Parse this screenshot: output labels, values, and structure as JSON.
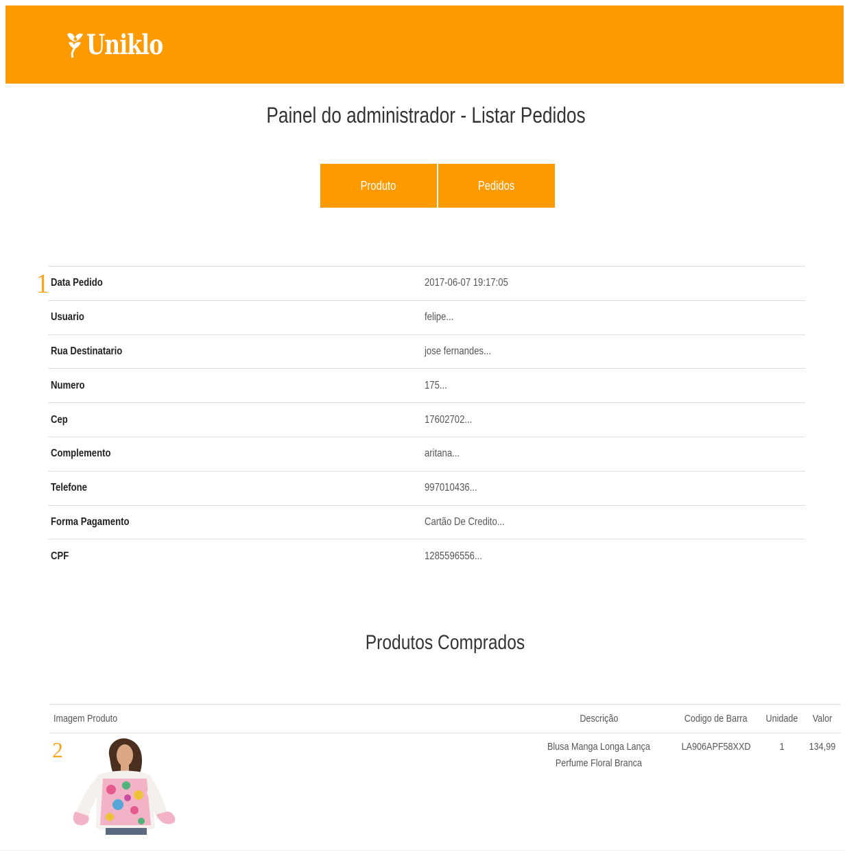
{
  "header": {
    "brand": "Uniklo",
    "logo_icon": "flower-logo-icon",
    "background_color": "#fe9a01"
  },
  "page_title": "Painel do administrador - Listar Pedidos",
  "nav": {
    "produto_label": "Produto",
    "pedidos_label": "Pedidos"
  },
  "order": {
    "index": "1",
    "fields": [
      {
        "label": "Data Pedido",
        "value": "2017-06-07 19:17:05"
      },
      {
        "label": "Usuario",
        "value": "felipe..."
      },
      {
        "label": "Rua Destinatario",
        "value": "jose fernandes..."
      },
      {
        "label": "Numero",
        "value": "175..."
      },
      {
        "label": "Cep",
        "value": "17602702..."
      },
      {
        "label": "Complemento",
        "value": "aritana..."
      },
      {
        "label": "Telefone",
        "value": "997010436..."
      },
      {
        "label": "Forma Pagamento",
        "value": "Cartão De Credito..."
      },
      {
        "label": "CPF",
        "value": "1285596556..."
      }
    ]
  },
  "products_section": {
    "title": "Produtos Comprados",
    "headers": {
      "image": "Imagem Produto",
      "description": "Descrição",
      "barcode": "Codigo de Barra",
      "unit": "Unidade",
      "value": "Valor"
    },
    "items": [
      {
        "index": "2",
        "description": "Blusa Manga Longa Lança Perfume Floral Branca",
        "barcode": "LA906APF58XXD",
        "unit": "1",
        "value": "134,99"
      }
    ]
  }
}
